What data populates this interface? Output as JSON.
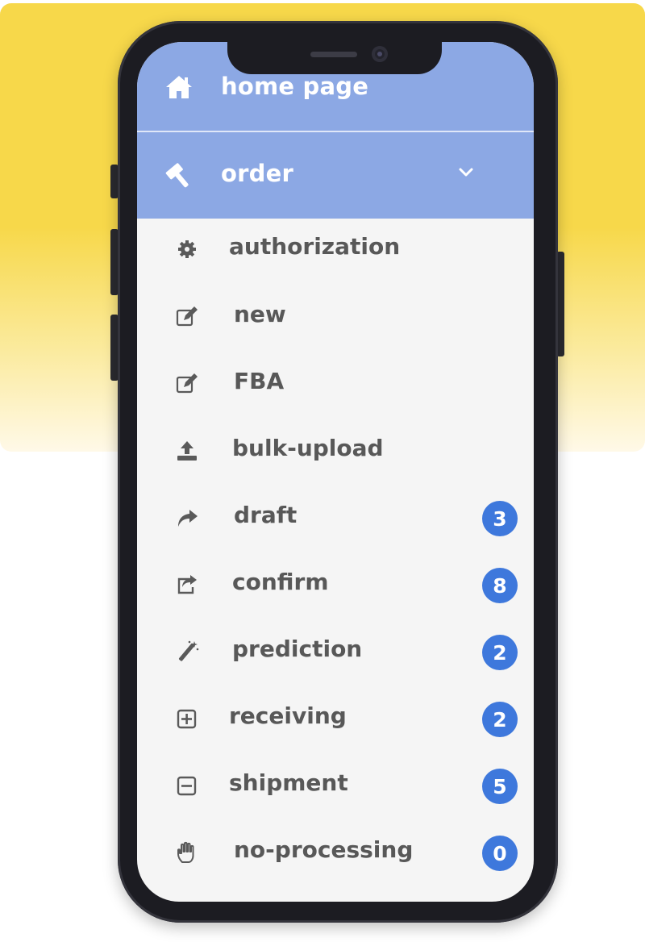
{
  "colors": {
    "header_bg": "#8ca8e4",
    "badge_bg": "#3e78dc",
    "menu_bg": "#f5f5f5",
    "text": "#585858",
    "backdrop": "#f7d84a"
  },
  "nav": {
    "home": {
      "label": "home page",
      "icon": "home-icon"
    },
    "order": {
      "label": "order",
      "icon": "gavel-icon",
      "expand_icon": "chevron-down-icon"
    }
  },
  "menu": {
    "items": [
      {
        "label": "authorization",
        "icon": "gear-icon",
        "badge": null
      },
      {
        "label": "new",
        "icon": "edit-icon",
        "badge": null
      },
      {
        "label": "FBA",
        "icon": "edit-icon",
        "badge": null
      },
      {
        "label": "bulk-upload",
        "icon": "upload-icon",
        "badge": null
      },
      {
        "label": "draft",
        "icon": "share-arrow-icon",
        "badge": "3"
      },
      {
        "label": "confirm",
        "icon": "share-square-icon",
        "badge": "8"
      },
      {
        "label": "prediction",
        "icon": "magic-wand-icon",
        "badge": "2"
      },
      {
        "label": "receiving",
        "icon": "plus-square-icon",
        "badge": "2"
      },
      {
        "label": "shipment",
        "icon": "minus-square-icon",
        "badge": "5"
      },
      {
        "label": "no-processing",
        "icon": "hand-icon",
        "badge": "0"
      }
    ]
  }
}
